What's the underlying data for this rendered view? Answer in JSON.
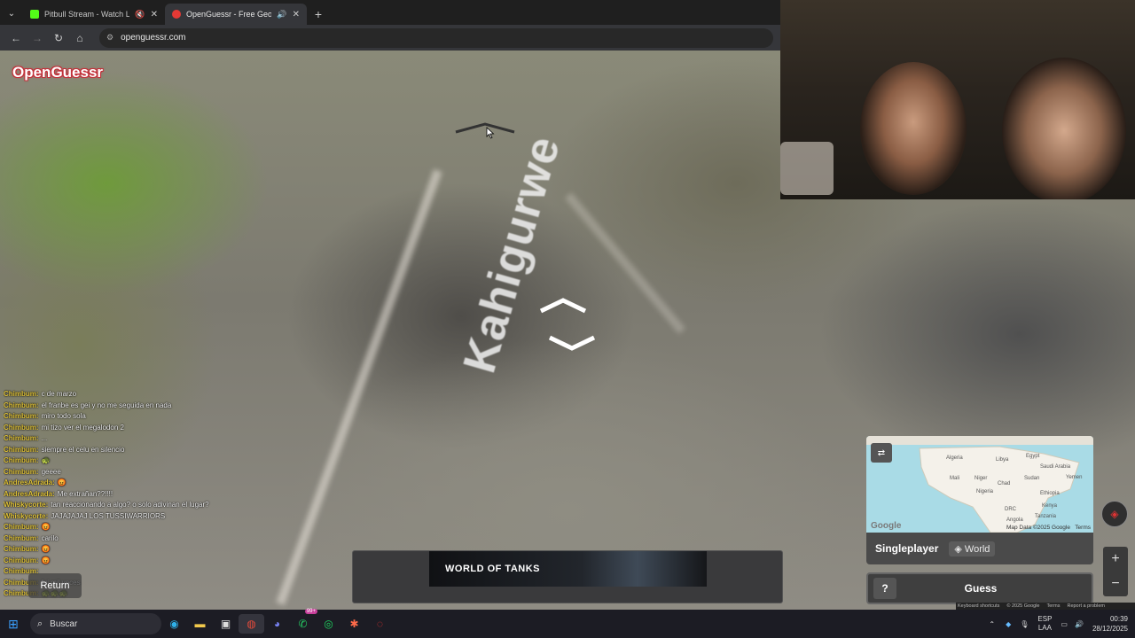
{
  "browser": {
    "tabs": [
      {
        "title": "Pitbull Stream - Watch Live",
        "favicon_color": "#53fc18",
        "muted": true,
        "active": false
      },
      {
        "title": "OpenGuessr - Free GeoGue",
        "favicon_color": "#e53935",
        "muted": false,
        "active": true
      }
    ],
    "new_tab": "+",
    "url": "openguessr.com"
  },
  "game": {
    "logo": "OpenGuessr",
    "street_label": "Kahigurwe",
    "return_label": "Return",
    "mode": "Singleplayer",
    "region": "World",
    "help_label": "?",
    "guess_label": "Guess",
    "map_attribution": "Map Data ©2025 Google",
    "map_terms": "Terms",
    "map_brand": "Google",
    "map_places": [
      "Algeria",
      "Libya",
      "Egypt",
      "Saudi Arabia",
      "Mali",
      "Niger",
      "Chad",
      "Sudan",
      "Yemen",
      "Nigeria",
      "Ethiopia",
      "DRC",
      "Kenya",
      "Tanzania",
      "Angola"
    ],
    "bottom_links": [
      "Keyboard shortcuts",
      "© 2025 Google",
      "Terms",
      "Report a problem"
    ]
  },
  "ad": {
    "brand": "WORLD OF TANKS"
  },
  "chat": [
    {
      "user": "Chimbum:",
      "text": "c de marzo"
    },
    {
      "user": "Chimbum:",
      "text": "el franbe es gei y no me seguida en nada"
    },
    {
      "user": "Chimbum:",
      "text": "miro todo sola"
    },
    {
      "user": "Chimbum:",
      "text": "mi tizo ver el megalodon 2"
    },
    {
      "user": "Chimbum:",
      "text": "..."
    },
    {
      "user": "Chimbum:",
      "text": "siempre el celu en silencio"
    },
    {
      "user": "Chimbum:",
      "text": "🐢"
    },
    {
      "user": "Chimbum:",
      "text": "geeee"
    },
    {
      "user": "AndresAdrada:",
      "text": "😡"
    },
    {
      "user": "AndresAdrada:",
      "text": "Me extrañan??!!!!"
    },
    {
      "user": "Whiskycorte:",
      "text": "tan reaccionando a algo? o solo adivinan el lugar?"
    },
    {
      "user": "Whiskycorte:",
      "text": "JAJAJAJAJ LOS TUSSIWARRIORS"
    },
    {
      "user": "Chimbum:",
      "text": "😡"
    },
    {
      "user": "Chimbum:",
      "text": "carilo"
    },
    {
      "user": "Chimbum:",
      "text": "😡"
    },
    {
      "user": "Chimbum:",
      "text": "😡"
    },
    {
      "user": "Chimbum:",
      "text": ""
    },
    {
      "user": "Chimbum:",
      "text": "fui mil veces"
    },
    {
      "user": "Chimbum:",
      "text": "🐢🐢🐢"
    }
  ],
  "taskbar": {
    "search_placeholder": "Buscar",
    "language": "ESP",
    "language_sub": "LAA",
    "time": "00:39",
    "date": "28/12/2025",
    "badge": "99+"
  }
}
